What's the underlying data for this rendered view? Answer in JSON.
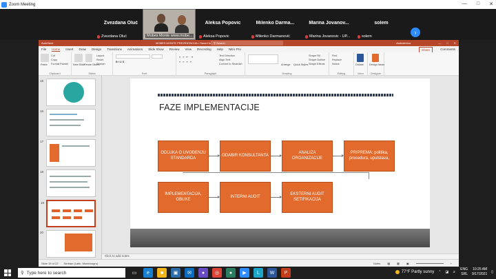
{
  "zoom": {
    "title": "Zoom Meeting",
    "participants": [
      {
        "display": "Zvezdana Oluć",
        "label": "Zvezdana Oluć"
      },
      {
        "display": "",
        "label": "Mobes Monte www.mobe...",
        "video": true
      },
      {
        "display": "Aleksa Popovic",
        "label": "Aleksa Popovic"
      },
      {
        "display": "Milenko Darma...",
        "label": "Milenko Darmanović"
      },
      {
        "display": "Marina Jovanov...",
        "label": "Marina Jovanovic - UP..."
      },
      {
        "display": "solem",
        "label": "solem"
      }
    ],
    "next_icon": "chevron-right-icon"
  },
  "ppt": {
    "autosave": "AutoSave",
    "doc_title": "MOBES MONTE PREZENTACIJA • Saved to this PC •",
    "search_placeholder": "Search",
    "user": "vladodenica",
    "menu": [
      "File",
      "Home",
      "Insert",
      "Draw",
      "Design",
      "Transitions",
      "Animations",
      "Slide Show",
      "Review",
      "View",
      "Recording",
      "Help",
      "Nitro Pro"
    ],
    "active_menu": "Home",
    "share": "Share",
    "comments": "Comments",
    "ribbon_groups": [
      "Clipboard",
      "Slides",
      "Font",
      "Paragraph",
      "Drawing",
      "Editing",
      "Voice",
      "Designer"
    ],
    "ribbon_labels": {
      "paste": "Paste",
      "cut": "Cut",
      "copy": "Copy",
      "format_painter": "Format Painter",
      "new_slide": "New Slide",
      "reuse_slides": "Reuse Slides",
      "layout": "Layout",
      "reset": "Reset",
      "section": "Section",
      "text_direction": "Text Direction",
      "align_text": "Align Text",
      "convert_smartart": "Convert to SmartArt",
      "arrange": "Arrange",
      "quick_styles": "Quick Styles",
      "shape_fill": "Shape Fill",
      "shape_outline": "Shape Outline",
      "shape_effects": "Shape Effects",
      "find": "Find",
      "replace": "Replace",
      "select": "Select",
      "dictate": "Dictate",
      "design_ideas": "Design Ideas"
    },
    "slide_numbers": [
      "15",
      "16",
      "17",
      "18",
      "19",
      "20"
    ],
    "selected_slide": "19",
    "slide": {
      "title": "FAZE IMPLEMENTACIJE",
      "row1": [
        "ODLUKA O UVOĐENJU STANDARDA",
        "ODABIR KONSULTANTA",
        "ANALIZA ORGANIZACIJE",
        "PRIPREMA: politika, procedura, uputstava,"
      ],
      "row2": [
        "IMPLEMENTACIJA, OBUKE",
        "INTERNI AUDIT",
        "EKSTERNI AUDIT SETIFIKACIJA"
      ]
    },
    "notes_placeholder": "Click to add notes",
    "status": {
      "slide_of": "Slide 19 of 22",
      "language": "Serbian (Latin, Montenegro)",
      "notes": "Notes",
      "zoom": "+"
    }
  },
  "taskbar": {
    "search_placeholder": "Type here to search",
    "weather": "77°F  Partly sunny",
    "lang": "ENG",
    "region": "SRL",
    "time": "10:25 AM",
    "date": "9/17/2021",
    "apps": [
      {
        "name": "task-view-icon",
        "color": "#1f1f1f",
        "glyph": "▭"
      },
      {
        "name": "edge-icon",
        "color": "#1b7fd1",
        "glyph": "e"
      },
      {
        "name": "file-explorer-icon",
        "color": "#f2b51c",
        "glyph": "■"
      },
      {
        "name": "store-icon",
        "color": "#2c6ca8",
        "glyph": "▣"
      },
      {
        "name": "mail-icon",
        "color": "#0f6cbd",
        "glyph": "✉"
      },
      {
        "name": "app-icon",
        "color": "#6a4bc4",
        "glyph": "●"
      },
      {
        "name": "chrome-icon",
        "color": "#db4437",
        "glyph": "◎"
      },
      {
        "name": "app-icon-2",
        "color": "#2a7f62",
        "glyph": "●"
      },
      {
        "name": "zoom-icon",
        "color": "#2d8cff",
        "glyph": "▶"
      },
      {
        "name": "libre-icon",
        "color": "#1aa5c9",
        "glyph": "L"
      },
      {
        "name": "word-icon",
        "color": "#2b579a",
        "glyph": "W"
      },
      {
        "name": "powerpoint-icon",
        "color": "#c43e1c",
        "glyph": "P"
      }
    ]
  }
}
